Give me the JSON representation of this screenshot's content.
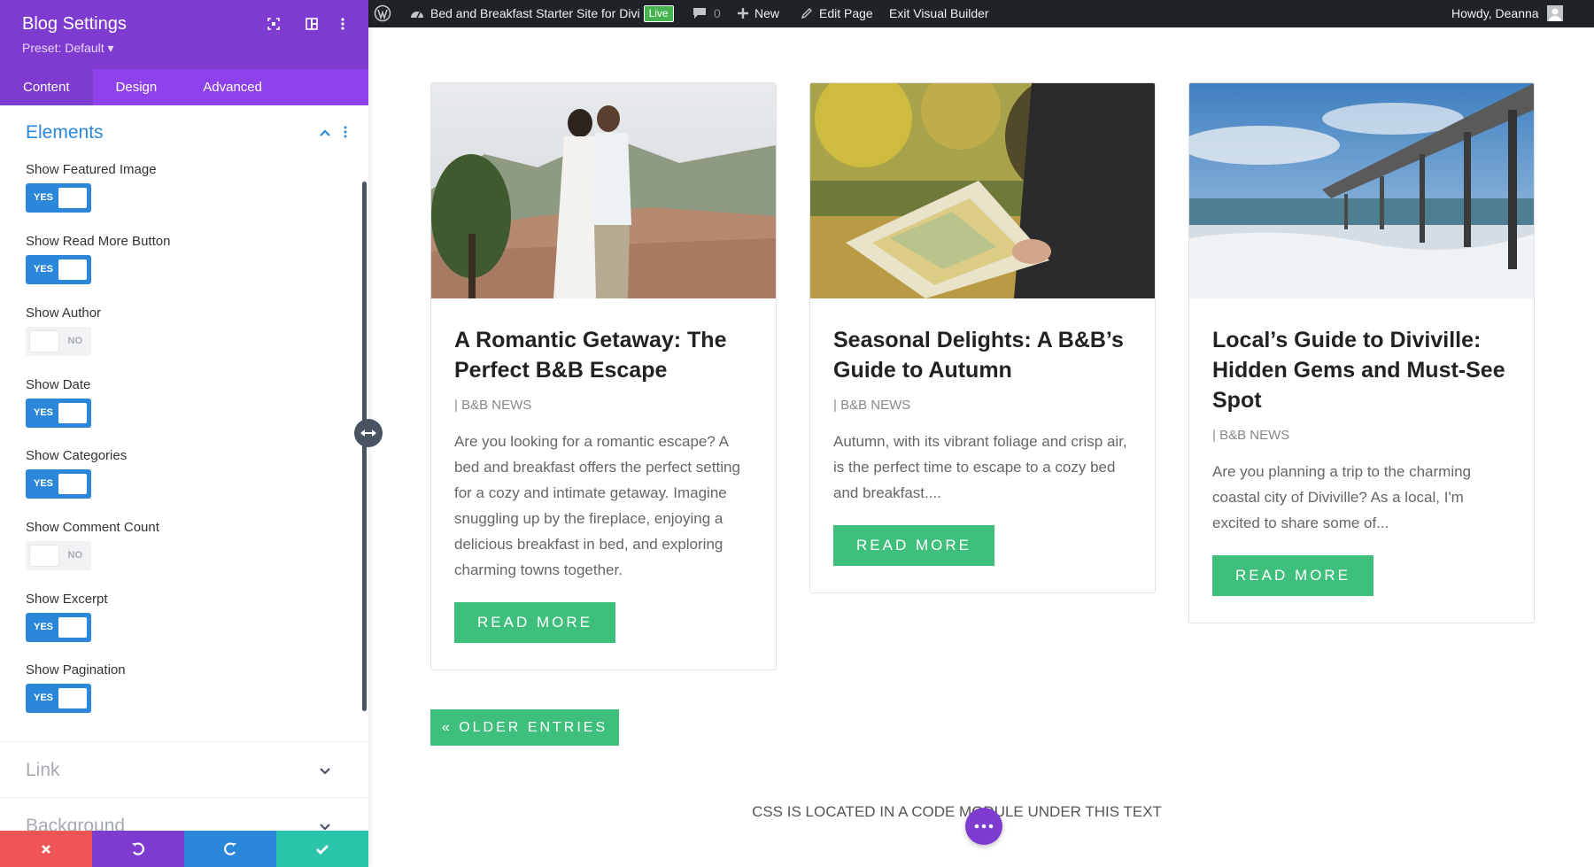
{
  "panel": {
    "title": "Blog Settings",
    "preset": "Preset: Default ▾",
    "tabs": [
      {
        "label": "Content",
        "active": true
      },
      {
        "label": "Design",
        "active": false
      },
      {
        "label": "Advanced",
        "active": false
      }
    ],
    "section_title": "Elements",
    "options": [
      {
        "label": "Show Featured Image",
        "state": "YES",
        "on": true
      },
      {
        "label": "Show Read More Button",
        "state": "YES",
        "on": true
      },
      {
        "label": "Show Author",
        "state": "NO",
        "on": false
      },
      {
        "label": "Show Date",
        "state": "YES",
        "on": true
      },
      {
        "label": "Show Categories",
        "state": "YES",
        "on": true
      },
      {
        "label": "Show Comment Count",
        "state": "NO",
        "on": false
      },
      {
        "label": "Show Excerpt",
        "state": "YES",
        "on": true
      },
      {
        "label": "Show Pagination",
        "state": "YES",
        "on": true
      }
    ],
    "collapsed_sections": [
      "Link",
      "Background"
    ],
    "footer": {
      "colors": [
        "#ef5555",
        "#7e3bd0",
        "#2b87da",
        "#29c4a9"
      ],
      "icons": [
        "close-icon",
        "undo-icon",
        "redo-icon",
        "check-icon"
      ]
    }
  },
  "admin_bar": {
    "site_name": "Bed and Breakfast Starter Site for Divi",
    "live_label": "Live",
    "comments_count": "0",
    "new_label": "New",
    "edit_label": "Edit Page",
    "exit_label": "Exit Visual Builder",
    "greeting": "Howdy, Deanna"
  },
  "posts": [
    {
      "title": "A Romantic Getaway: The Perfect B&B Escape",
      "meta": "| B&B NEWS",
      "excerpt": "Are you looking for a romantic escape? A bed and breakfast offers the perfect setting for a cozy and intimate getaway. Imagine snuggling up by the fireplace, enjoying a delicious breakfast in bed, and exploring charming towns together.",
      "button": "READ MORE"
    },
    {
      "title": "Seasonal Delights: A B&B’s Guide to Autumn",
      "meta": "| B&B NEWS",
      "excerpt": "Autumn, with its vibrant foliage and crisp air, is the perfect time to escape to a cozy bed and breakfast....",
      "button": "READ MORE"
    },
    {
      "title": "Local’s Guide to Diviville: Hidden Gems and Must-See Spot",
      "meta": "| B&B NEWS",
      "excerpt": "Are you planning a trip to the charming coastal city of Diviville? As a local, I'm excited to share some of...",
      "button": "READ MORE"
    }
  ],
  "pagination": {
    "older_label": "« OLDER ENTRIES"
  },
  "css_note": "CSS IS LOCATED IN A CODE MODULE UNDER THIS TEXT",
  "colors": {
    "accent_purple": "#7e3bd0",
    "accent_blue": "#2b87da",
    "button_green": "#3ec07c"
  }
}
